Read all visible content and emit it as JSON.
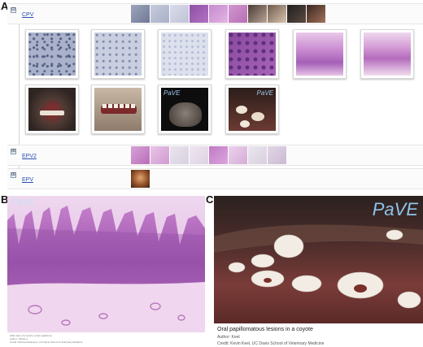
{
  "labels": {
    "a": "A",
    "b": "B",
    "c": "C"
  },
  "panel_a": {
    "rows": [
      {
        "toggle": "⊟",
        "name": "CPV",
        "expanded": true
      },
      {
        "toggle": "⊞",
        "name": "EPV2",
        "expanded": false
      },
      {
        "toggle": "⊞",
        "name": "EPV",
        "expanded": false
      }
    ],
    "thumb_watermarks": [
      "PaVE",
      "PaVE"
    ]
  },
  "panel_b": {
    "watermark": "PaVE",
    "caption_lines": [
      "H&E stain of a canine ocular papilloma",
      "Author: Tobias a",
      "Credit: Patricia Pesavento, UC Davis School of Veterinary Medicine"
    ]
  },
  "panel_c": {
    "watermark": "PaVE",
    "title": "Oral papillomatous lesions in a coyote",
    "author": "Author: Keet",
    "credit": "Credit: Kevin Keel, UC Davis School of Veterinary Medicine"
  },
  "colors": {
    "link": "#2a4fb5",
    "he_pink": "#c58ac4",
    "he_purple": "#8e4fa6",
    "watermark": "#9ec9ef"
  }
}
